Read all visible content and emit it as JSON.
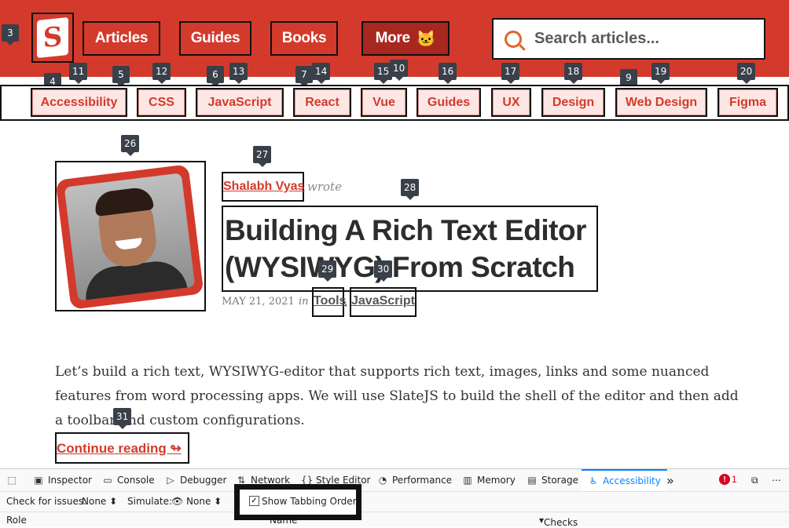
{
  "header": {
    "logo_letter": "S",
    "nav": [
      {
        "label": "Articles"
      },
      {
        "label": "Guides"
      },
      {
        "label": "Books"
      },
      {
        "label": "More"
      }
    ],
    "search_placeholder": "Search articles..."
  },
  "tab_order": {
    "n3": "3",
    "n4": "4",
    "n5": "5",
    "n6": "6",
    "n7": "7",
    "n9": "9",
    "n10": "10",
    "n11": "11",
    "n12": "12",
    "n13": "13",
    "n14": "14",
    "n15": "15",
    "n16": "16",
    "n17": "17",
    "n18": "18",
    "n19": "19",
    "n20": "20",
    "n26": "26",
    "n27": "27",
    "n28": "28",
    "n29": "29",
    "n30": "30",
    "n31": "31"
  },
  "tags": [
    "Accessibility",
    "CSS",
    "JavaScript",
    "React",
    "Vue",
    "Guides",
    "UX",
    "Design",
    "Web Design",
    "Figma"
  ],
  "article": {
    "author": "Shalabh Vyas",
    "wrote": "wrote",
    "title_line1": "Building A Rich Text Editor",
    "title_line2": "(WYSIWYG) From Scratch",
    "date": "MAY 21, 2021",
    "in": "in",
    "tag1": "Tools",
    "tag2": "JavaScript",
    "excerpt": "Let’s build a rich text, WYSIWYG-editor that supports rich text, images, links and some nuanced features from word processing apps. We will use SlateJS to build the shell of the editor and then add a toolbar and custom configurations.",
    "continue": "Continue reading ↬"
  },
  "devtools": {
    "tabs": [
      {
        "icon": "▣",
        "label": "Inspector"
      },
      {
        "icon": "▭",
        "label": "Console"
      },
      {
        "icon": "▷",
        "label": "Debugger"
      },
      {
        "icon": "⇅",
        "label": "Network"
      },
      {
        "icon": "{}",
        "label": "Style Editor"
      },
      {
        "icon": "◔",
        "label": "Performance"
      },
      {
        "icon": "▥",
        "label": "Memory"
      },
      {
        "icon": "▤",
        "label": "Storage"
      },
      {
        "icon": "♿",
        "label": "Accessibility"
      }
    ],
    "overflow": "»",
    "error_count": "1",
    "check_issues_label": "Check for issues:",
    "check_issues_value": "None ⬍",
    "simulate_label": "Simulate:",
    "simulate_value": "👁 None ⬍",
    "show_tabbing_order": "Show Tabbing Order",
    "col_role": "Role",
    "col_name": "Name",
    "col_checks": "Checks"
  }
}
